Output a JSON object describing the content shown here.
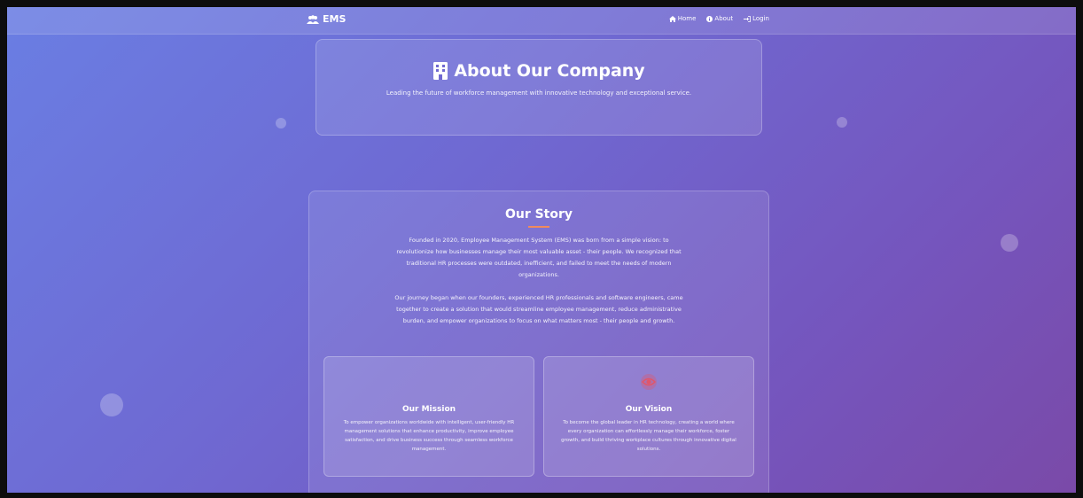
{
  "navbar": {
    "brand": "EMS",
    "brand_icon": "users-icon",
    "links": [
      {
        "label": "Home",
        "icon": "home-icon"
      },
      {
        "label": "About",
        "icon": "info-icon"
      },
      {
        "label": "Login",
        "icon": "login-icon"
      }
    ]
  },
  "hero": {
    "icon": "building-icon",
    "title": "About Our Company",
    "subtitle": "Leading the future of workforce management with innovative technology and exceptional service."
  },
  "story": {
    "title": "Our Story",
    "paragraphs": [
      "Founded in 2020, Employee Management System (EMS) was born from a simple vision: to revolutionize how businesses manage their most valuable asset - their people. We recognized that traditional HR processes were outdated, inefficient, and failed to meet the needs of modern organizations.",
      "Our journey began when our founders, experienced HR professionals and software engineers, came together to create a solution that would streamline employee management, reduce administrative burden, and empower organizations to focus on what matters most - their people and growth."
    ],
    "accent_color": "#f08a5d"
  },
  "cards": {
    "mission": {
      "title": "Our Mission",
      "text": "To empower organizations worldwide with intelligent, user-friendly HR management solutions that enhance productivity, improve employee satisfaction, and drive business success through seamless workforce management."
    },
    "vision": {
      "icon": "eye-icon",
      "icon_color": "#e0566a",
      "title": "Our Vision",
      "text": "To become the global leader in HR technology, creating a world where every organization can effortlessly manage their workforce, foster growth, and build thriving workplace cultures through innovative digital solutions."
    }
  }
}
